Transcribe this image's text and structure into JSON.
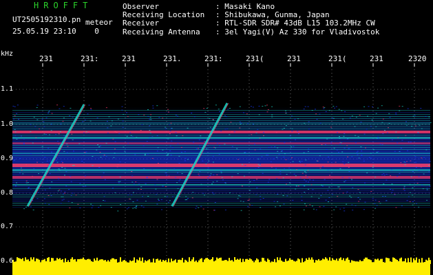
{
  "header": {
    "brand": "HROFFT",
    "file_name": "UT2505192310.pn",
    "file_suffix": "meteor",
    "date_time": "25.05.19 23:10",
    "counter": "0",
    "info": [
      {
        "label": "Observer",
        "value": ": Masaki Kano"
      },
      {
        "label": "Receiving Location",
        "value": ": Shibukawa, Gunma, Japan"
      },
      {
        "label": "Receiver",
        "value": ": RTL-SDR SDR# 43dB L15 103.2MHz CW"
      },
      {
        "label": "Receiving Antenna",
        "value": ": 3el Yagi(V) Az 330 for Vladivostok"
      }
    ]
  },
  "axes": {
    "y_unit": "kHz",
    "x_ticks": [
      "231",
      "231:",
      "231",
      "231.",
      "231:",
      "231(",
      "231",
      "231(",
      "231",
      "2320"
    ],
    "y_ticks": [
      "1.1",
      "1.0",
      "0.9",
      "0.8",
      "0.7",
      "0.6"
    ]
  },
  "colors": {
    "background": "#000000",
    "brand": "#2bd32b",
    "grid": "#ffffff",
    "signal_low": "#1a3cff",
    "signal_mid": "#19d7c8",
    "signal_high": "#ff3a6a",
    "level_bar": "#ffee00"
  }
}
